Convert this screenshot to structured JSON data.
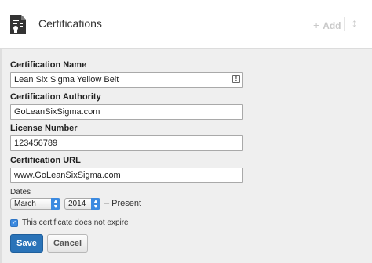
{
  "header": {
    "title": "Certifications",
    "add_label": "Add",
    "add_icon": "plus-icon",
    "reorder_icon": "reorder-arrows-icon",
    "section_icon": "certificate-document-icon"
  },
  "form": {
    "certification_name": {
      "label": "Certification Name",
      "value": "Lean Six Sigma Yellow Belt"
    },
    "certification_authority": {
      "label": "Certification Authority",
      "value": "GoLeanSixSigma.com"
    },
    "license_number": {
      "label": "License Number",
      "value": "123456789"
    },
    "certification_url": {
      "label": "Certification URL",
      "value": "www.GoLeanSixSigma.com"
    },
    "dates": {
      "label": "Dates",
      "month": "March",
      "year": "2014",
      "end_text": "– Present"
    },
    "no_expire": {
      "label": "This certificate does not expire",
      "checked": true
    },
    "save_label": "Save",
    "cancel_label": "Cancel"
  },
  "colors": {
    "accent": "#2a73b8",
    "select_arrow": "#3c8ae0",
    "form_background": "#efefef"
  }
}
